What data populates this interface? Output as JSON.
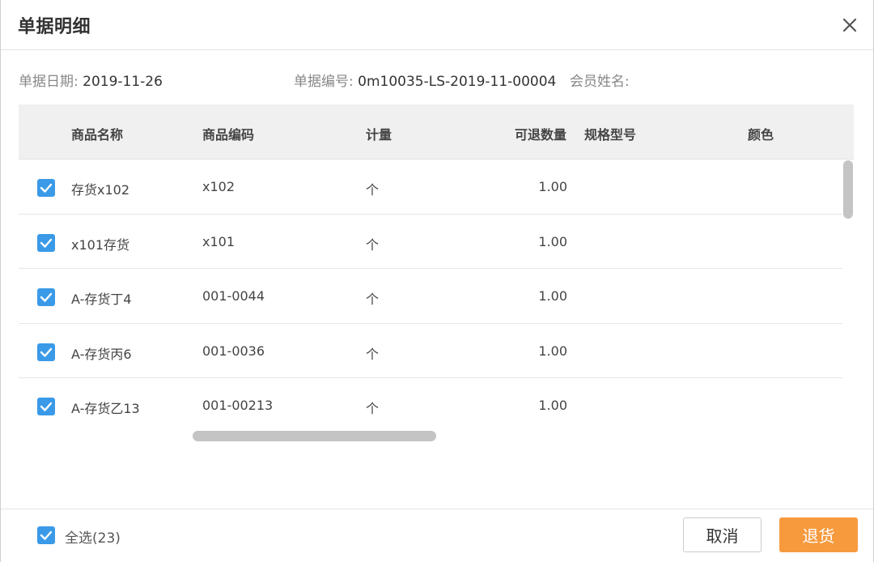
{
  "dialog": {
    "title": "单据明细"
  },
  "info": {
    "date_label": "单据日期:",
    "date_value": "2019-11-26",
    "no_label": "单据编号:",
    "no_value": "0m10035-LS-2019-11-00004",
    "member_label": "会员姓名:",
    "member_value": ""
  },
  "table": {
    "columns": [
      "商品名称",
      "商品编码",
      "计量",
      "可退数量",
      "规格型号",
      "颜色"
    ],
    "rows": [
      {
        "name": "存货x102",
        "code": "x102",
        "unit": "个",
        "qty": "1.00",
        "spec": "",
        "color": "",
        "checked": true
      },
      {
        "name": "x101存货",
        "code": "x101",
        "unit": "个",
        "qty": "1.00",
        "spec": "",
        "color": "",
        "checked": true
      },
      {
        "name": "A-存货丁4",
        "code": "001-0044",
        "unit": "个",
        "qty": "1.00",
        "spec": "",
        "color": "",
        "checked": true
      },
      {
        "name": "A-存货丙6",
        "code": "001-0036",
        "unit": "个",
        "qty": "1.00",
        "spec": "",
        "color": "",
        "checked": true
      },
      {
        "name": "A-存货乙13",
        "code": "001-00213",
        "unit": "个",
        "qty": "1.00",
        "spec": "",
        "color": "",
        "checked": true
      }
    ]
  },
  "footer": {
    "select_all_label": "全选(23)",
    "select_all_checked": true,
    "cancel_label": "取消",
    "return_label": "退货"
  },
  "colors": {
    "accent_blue": "#3a9ae8",
    "primary_orange": "#f79a3e",
    "header_bg": "#f0f0f0"
  },
  "icons": {
    "close": "close-icon",
    "checkbox": "checkmark-icon"
  }
}
